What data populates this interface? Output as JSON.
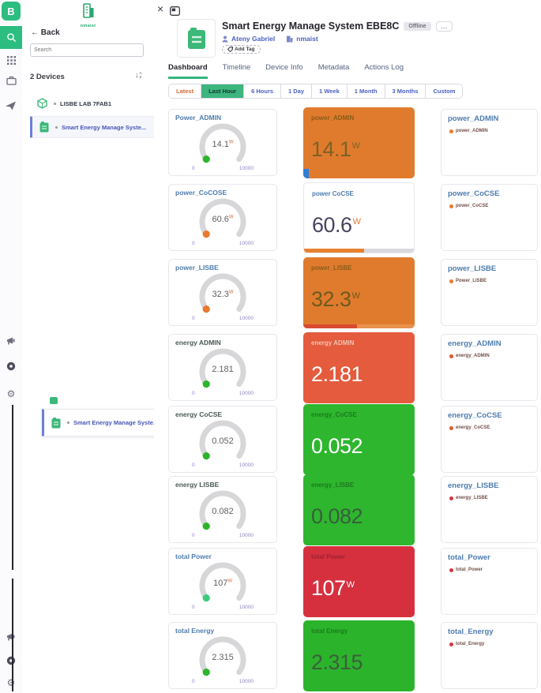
{
  "brand": {
    "letter": "B",
    "green": "#2cbd80"
  },
  "window": {
    "close": "×"
  },
  "sidebar": {
    "org_name": "nmaist",
    "back_arrow": "←",
    "back_label": "Back",
    "search_placeholder": "Search",
    "devices_header": "2 Devices",
    "devices": [
      {
        "name": "LISBE LAB 7FAB1",
        "icon": "cube-icon",
        "selected": false
      },
      {
        "name": "Smart Energy Manage Syste...",
        "icon": "device-icon",
        "selected": true
      }
    ],
    "duplicate_device": "Smart Energy Manage Syste..."
  },
  "header": {
    "title": "Smart Energy Manage System EBE8C",
    "status_badge": "Offline",
    "more_label": "…",
    "owner": "Ateny Gabriel",
    "org": "nmaist",
    "add_tag_label": "Add Tag"
  },
  "tabs": [
    {
      "label": "Dashboard",
      "active": true
    },
    {
      "label": "Timeline",
      "active": false
    },
    {
      "label": "Device Info",
      "active": false
    },
    {
      "label": "Metadata",
      "active": false
    },
    {
      "label": "Actions Log",
      "active": false
    }
  ],
  "time_ranges": [
    {
      "label": "Latest",
      "selected": false,
      "text_color": "#d4693a"
    },
    {
      "label": "Last Hour",
      "selected": true
    },
    {
      "label": "6 Hours",
      "selected": false
    },
    {
      "label": "1 Day",
      "selected": false
    },
    {
      "label": "1 Week",
      "selected": false
    },
    {
      "label": "1 Month",
      "selected": false
    },
    {
      "label": "3 Months",
      "selected": false
    },
    {
      "label": "Custom",
      "selected": false
    }
  ],
  "widgets": [
    {
      "gauge": {
        "title": "Power_ADMIN",
        "title_color": "#4f7cae",
        "value": "14.1",
        "unit": "W",
        "min": "0",
        "max": "10000",
        "dot": "#2cb52c"
      },
      "tile": {
        "title": "power_ADMIN",
        "value": "14.1",
        "unit": "W",
        "bg": "#e07b2e",
        "label_color": "#8a5c17",
        "value_color": "#7d6126",
        "bar": {
          "type": "corner",
          "color": "#2f7ed8"
        }
      },
      "chart": {
        "title": "power_ADMIN",
        "legend": "power_ADMIN",
        "dot": "#e8792e"
      }
    },
    {
      "gauge": {
        "title": "power_CoCOSE",
        "title_color": "#4f7cae",
        "value": "60.6",
        "unit": "W",
        "min": "0",
        "max": "10000",
        "dot": "#e8792e"
      },
      "tile": {
        "title": "power CoCSE",
        "value": "60.6",
        "unit": "W",
        "bg": "#ffffff",
        "bordered": true,
        "label_color": "#4f7cae",
        "value_color": "#474360",
        "unit_color": "#e07b2e",
        "bar": {
          "type": "progress",
          "fill": "#e8812f",
          "track": "#d9d9de",
          "pct": 55
        }
      },
      "chart": {
        "title": "power_CoCSE",
        "legend": "power_CoCSE",
        "dot": "#e8792e"
      }
    },
    {
      "gauge": {
        "title": "power_LISBE",
        "title_color": "#4f7cae",
        "value": "32.3",
        "unit": "W",
        "min": "0",
        "max": "10000",
        "dot": "#e8792e"
      },
      "tile": {
        "title": "power_LISBE",
        "value": "32.3",
        "unit": "W",
        "bg": "#e07b2e",
        "label_color": "#8a5c17",
        "value_color": "#6e5a1e",
        "bar": {
          "type": "progress",
          "fill": "#d84a31",
          "track": "#e8934d",
          "pct": 48
        }
      },
      "chart": {
        "title": "power_LISBE",
        "legend": "Power_LISBE",
        "dot": "#e8792e"
      }
    },
    {
      "gauge": {
        "title": "energy ADMIN",
        "title_color": "#4a5a55",
        "value": "2.181",
        "unit": "",
        "min": "0",
        "max": "10000",
        "dot": "#2cb52c"
      },
      "tile": {
        "title": "energy ADMIN",
        "value": "2.181",
        "unit": "",
        "bg": "#e45b3d",
        "label_color": "#f2c3b4",
        "value_color": "#ffffff"
      },
      "chart": {
        "title": "energy_ADMIN",
        "legend": "energy_ADMIN",
        "dot": "#e0552f"
      }
    },
    {
      "gauge": {
        "title": "energy CoCSE",
        "title_color": "#4a5a55",
        "value": "0.052",
        "unit": "",
        "min": "0",
        "max": "10000",
        "dot": "#2cb52c"
      },
      "tile": {
        "title": "energy_CoCSE",
        "value": "0.052",
        "unit": "",
        "bg": "#2eb62e",
        "label_color": "#1d7a1d",
        "value_color": "#ffffff"
      },
      "chart": {
        "title": "energy_CoCSE",
        "legend": "energy_CoCSE",
        "dot": "#e0552f"
      }
    },
    {
      "gauge": {
        "title": "energy LISBE",
        "title_color": "#4a5a55",
        "value": "0.082",
        "unit": "",
        "min": "0",
        "max": "10000",
        "dot": "#2cb52c"
      },
      "tile": {
        "title": "energy_LISBE",
        "value": "0.082",
        "unit": "",
        "bg": "#2eb62e",
        "label_color": "#1d7a1d",
        "value_color": "#36603a"
      },
      "chart": {
        "title": "energy_LISBE",
        "legend": "energy_LISBE",
        "dot": "#d93440"
      }
    },
    {
      "gauge": {
        "title": "total Power",
        "title_color": "#4f7cae",
        "value": "107",
        "unit": "W",
        "min": "0",
        "max": "10000",
        "dot": "#3ecb7f"
      },
      "tile": {
        "title": "total Power",
        "value": "107",
        "unit": "W",
        "bg": "#d6303f",
        "label_color": "#9c2230",
        "value_color": "#ffffff"
      },
      "chart": {
        "title": "total_Power",
        "legend": "total_Power",
        "dot": "#d93440"
      }
    },
    {
      "gauge": {
        "title": "total Energy",
        "title_color": "#4f7cae",
        "value": "2.315",
        "unit": "",
        "min": "0",
        "max": "10000",
        "dot": "#2cb52c"
      },
      "tile": {
        "title": "total Energy",
        "value": "2.315",
        "unit": "",
        "bg": "#2bb42b",
        "label_color": "#1d7a1d",
        "value_color": "#3c5f3c"
      },
      "chart": {
        "title": "total_Energy",
        "legend": "total_Energy",
        "dot": "#d93440"
      }
    }
  ]
}
